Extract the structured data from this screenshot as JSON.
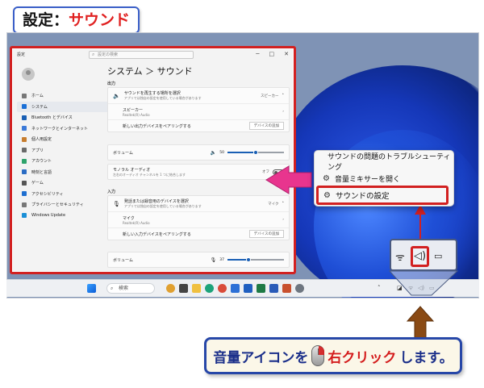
{
  "header": {
    "title_prefix": "設定：",
    "title_accent": "サウンド"
  },
  "settings_window": {
    "title": "設定",
    "search_placeholder": "設定の検索",
    "breadcrumb": "システム ＞ サウンド",
    "nav_items": [
      {
        "label": "ホーム",
        "icon": "home-icon"
      },
      {
        "label": "システム",
        "icon": "system-icon",
        "active": true
      },
      {
        "label": "Bluetooth とデバイス",
        "icon": "bluetooth-icon"
      },
      {
        "label": "ネットワークとインターネット",
        "icon": "network-icon"
      },
      {
        "label": "個人用設定",
        "icon": "brush-icon"
      },
      {
        "label": "アプリ",
        "icon": "apps-icon"
      },
      {
        "label": "アカウント",
        "icon": "account-icon"
      },
      {
        "label": "時刻と言語",
        "icon": "clock-icon"
      },
      {
        "label": "ゲーム",
        "icon": "game-icon"
      },
      {
        "label": "アクセシビリティ",
        "icon": "accessibility-icon"
      },
      {
        "label": "プライバシーとセキュリティ",
        "icon": "shield-icon"
      },
      {
        "label": "Windows Update",
        "icon": "update-icon"
      }
    ],
    "output": {
      "section": "出力",
      "choose_label": "サウンドを再生する場所を選択",
      "choose_sub": "アプリでは独自の設定を使用している場合があります",
      "choose_value": "スピーカー",
      "speaker_label": "スピーカー",
      "speaker_sub": "Realtek(R) Audio",
      "pair_label": "新しい出力デバイスをペアリングする",
      "add_device": "デバイスの追加",
      "volume_label": "ボリューム",
      "volume_value": "50",
      "mono_label": "モノラル オーディオ",
      "mono_sub": "左右のオーディオ チャンネルを 1 つに結合します",
      "mono_state": "オフ"
    },
    "input": {
      "section": "入力",
      "choose_label": "発話または録音用のデバイスを選択",
      "choose_sub": "アプリでは独自の設定を使用している場合があります",
      "choose_value": "マイク",
      "mic_label": "マイク",
      "mic_sub": "Realtek(R) Audio",
      "pair_label": "新しい入力デバイスをペアリングする",
      "add_device": "デバイスの追加",
      "volume_label": "ボリューム",
      "volume_value": "37"
    }
  },
  "taskbar": {
    "search_label": "検索"
  },
  "context_menu": {
    "items": [
      {
        "label": "サウンドの問題のトラブルシューティング"
      },
      {
        "label": "音量ミキサーを開く"
      },
      {
        "label": "サウンドの設定"
      }
    ]
  },
  "instruction": {
    "part1": "音量アイコンを",
    "part2": "右クリック",
    "part3": "します。"
  },
  "colors": {
    "highlight_red": "#d22020",
    "accent_blue": "#1a5fb4",
    "frame_navy": "#2747a8",
    "arrow_brown": "#8a4a14",
    "arrow_pink": "#e8358e"
  }
}
